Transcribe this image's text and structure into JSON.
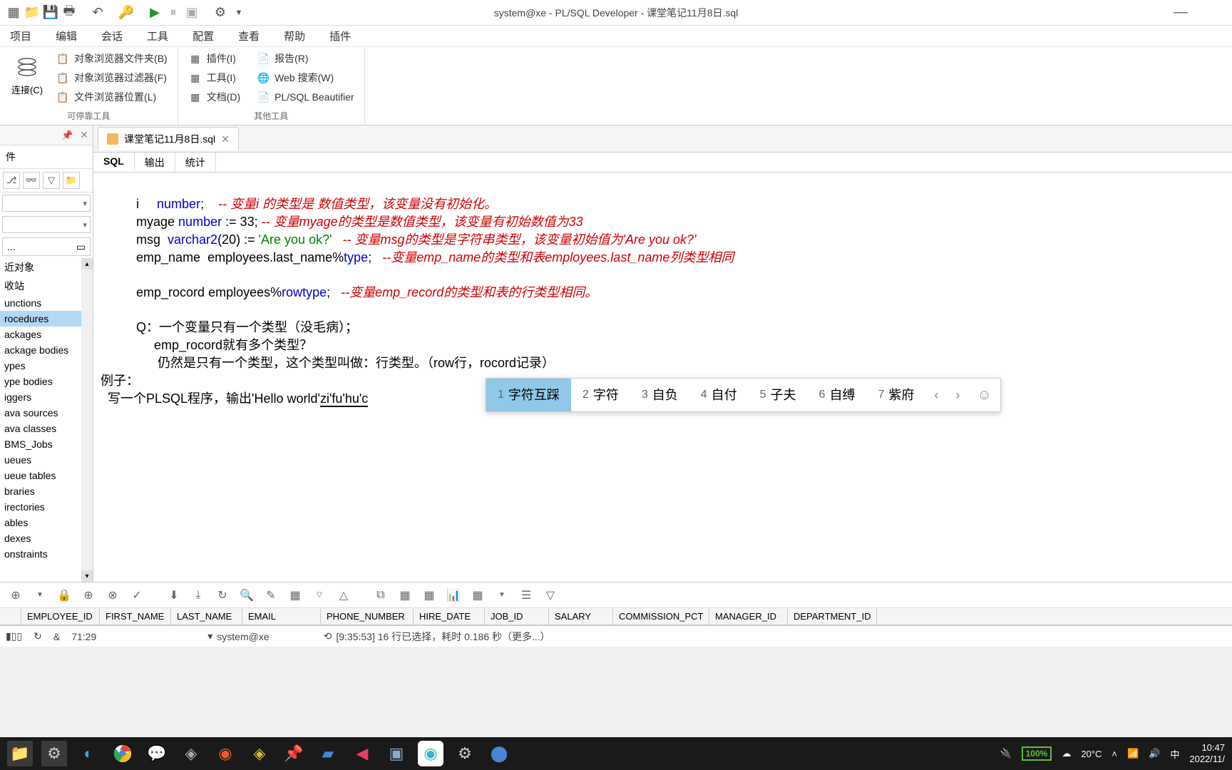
{
  "title": "system@xe - PL/SQL Developer - 课堂笔记11月8日.sql",
  "menu": [
    "项目",
    "编辑",
    "会话",
    "工具",
    "配置",
    "查看",
    "帮助",
    "插件"
  ],
  "ribbon": {
    "group1_label": "连接(C)",
    "group1_sub": "可停靠工具",
    "items1": [
      "对象浏览器文件夹(B)",
      "对象浏览器过滤器(F)",
      "文件浏览器位置(L)"
    ],
    "group2_label": "其他工具",
    "items2a": [
      "插件(I)",
      "工具(I)",
      "文档(D)"
    ],
    "items2b": [
      "报告(R)",
      "Web 搜索(W)",
      "PL/SQL Beautifier"
    ]
  },
  "leftPanel": {
    "tab": "件",
    "pathDots": "...",
    "tree": [
      "近对象",
      "收站",
      "unctions",
      "rocedures",
      "ackages",
      "ackage bodies",
      "ypes",
      "ype bodies",
      "iggers",
      "ava sources",
      "ava classes",
      "BMS_Jobs",
      "ueues",
      "ueue tables",
      "braries",
      "irectories",
      "ables",
      "dexes",
      "onstraints"
    ],
    "selectedIndex": 3
  },
  "tabs": {
    "file": "课堂笔记11月8日.sql",
    "sub": [
      "SQL",
      "输出",
      "统计"
    ]
  },
  "code": {
    "l1_var": "i     ",
    "l1_kw": "number",
    "l1_end": ";    ",
    "l1_cmt": "-- 变量i 的类型是 数值类型，该变量没有初始化。",
    "l2_var": "myage ",
    "l2_kw": "number",
    "l2_mid": " := 33; ",
    "l2_cmt": "-- 变量myage的类型是数值类型，该变量有初始数值为33",
    "l3_var": "msg  ",
    "l3_kw": "varchar2",
    "l3_paren": "(20) := ",
    "l3_str": "'Are you ok?'",
    "l3_sp": "   ",
    "l3_cmt": "-- 变量msg的类型是字符串类型，该变量初始值为'Are you ok?'",
    "l4_var": "emp_name  employees.last_name%",
    "l4_kw": "type",
    "l4_end": ";   ",
    "l4_cmt": "--变量emp_name的类型和表employees.last_name列类型相同",
    "l5_var": "emp_rocord employees%",
    "l5_kw": "rowtype",
    "l5_end": ";   ",
    "l5_cmt": "--变量emp_record的类型和表的行类型相同。",
    "l6": "Q：一个变量只有一个类型（没毛病）；",
    "l7": "     emp_rocord就有多个类型？",
    "l8": "      仍然是只有一个类型，这个类型叫做：行类型。（row行，rocord记录）",
    "l9": "例子：",
    "l10a": "  写一个PLSQL程序，输出'Hello world'",
    "l10b": "zi'fu'hu'c"
  },
  "ime": {
    "cands": [
      {
        "n": "1",
        "t": "字符互踩"
      },
      {
        "n": "2",
        "t": "字符"
      },
      {
        "n": "3",
        "t": "自负"
      },
      {
        "n": "4",
        "t": "自付"
      },
      {
        "n": "5",
        "t": "子夫"
      },
      {
        "n": "6",
        "t": "自缚"
      },
      {
        "n": "7",
        "t": "紫府"
      }
    ]
  },
  "columns": [
    "EMPLOYEE_ID",
    "FIRST_NAME",
    "LAST_NAME",
    "EMAIL",
    "PHONE_NUMBER",
    "HIRE_DATE",
    "JOB_ID",
    "SALARY",
    "COMMISSION_PCT",
    "MANAGER_ID",
    "DEPARTMENT_ID"
  ],
  "status": {
    "pos": "71:29",
    "conn": "system@xe",
    "info": "[9:35:53] 16 行已选择，耗时 0.186 秒（更多...）"
  },
  "taskbar": {
    "battery": "100%",
    "weather": "20°C",
    "lang": "中",
    "time": "10:47",
    "date": "2022/11/"
  }
}
